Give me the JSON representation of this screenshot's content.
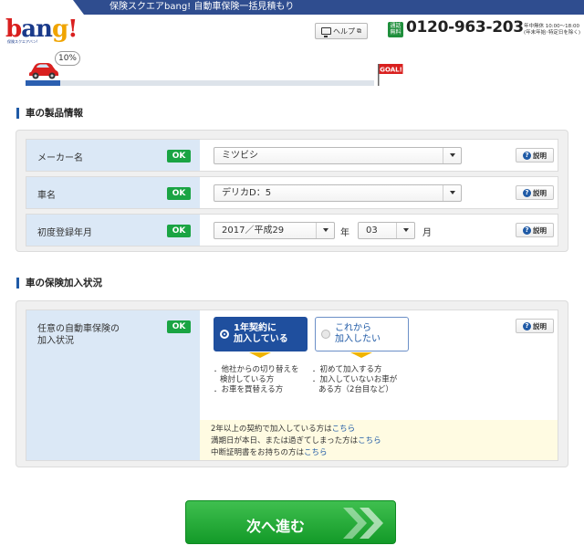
{
  "header": {
    "title": "保険スクエアbang! 自動車保険一括見積もり",
    "logo_text": "bang!",
    "logo_sub": "保険スクエアバン!",
    "help_label": "ヘルプ",
    "free_badge": "通話無料",
    "phone": "0120-963-203",
    "hours_line1": "年中無休 10:00～18:00",
    "hours_line2": "(年末年始･特定日を除く)"
  },
  "progress": {
    "percent_label": "10%",
    "percent": 10,
    "goal_label": "GOAL!"
  },
  "section1": {
    "title": "車の製品情報",
    "maker": {
      "label": "メーカー名",
      "ok": "OK",
      "value": "ミツビシ",
      "explain": "説明"
    },
    "car_name": {
      "label": "車名",
      "ok": "OK",
      "value": "デリカD：5",
      "explain": "説明"
    },
    "first_reg": {
      "label": "初度登録年月",
      "ok": "OK",
      "year_value": "2017／平成29",
      "year_unit": "年",
      "month_value": "03",
      "month_unit": "月",
      "explain": "説明"
    }
  },
  "section2": {
    "title": "車の保険加入状況",
    "label_line1": "任意の自動車保険の",
    "label_line2": "加入状況",
    "ok": "OK",
    "explain": "説明",
    "choice_on_line1": "1年契約に",
    "choice_on_line2": "加入している",
    "choice_off_line1": "これから",
    "choice_off_line2": "加入したい",
    "desc_on_line1": "．他社からの切り替えを",
    "desc_on_line2": "検討している方",
    "desc_on_line3": "．お車を買替える方",
    "desc_off_line1": "．初めて加入する方",
    "desc_off_line2": "．加入していないお車が",
    "desc_off_line3": "ある方（2台目など）",
    "note1_text": "2年以上の契約で加入している方は",
    "note2_text": "満期日が本日、または過ぎてしまった方は",
    "note3_text": "中断証明書をお持ちの方は",
    "note_link": "こちら"
  },
  "next_button": {
    "label": "次へ進む"
  },
  "colors": {
    "brand_blue": "#2f4d8f",
    "ok_green": "#1aa443",
    "next_green": "#139a28"
  }
}
